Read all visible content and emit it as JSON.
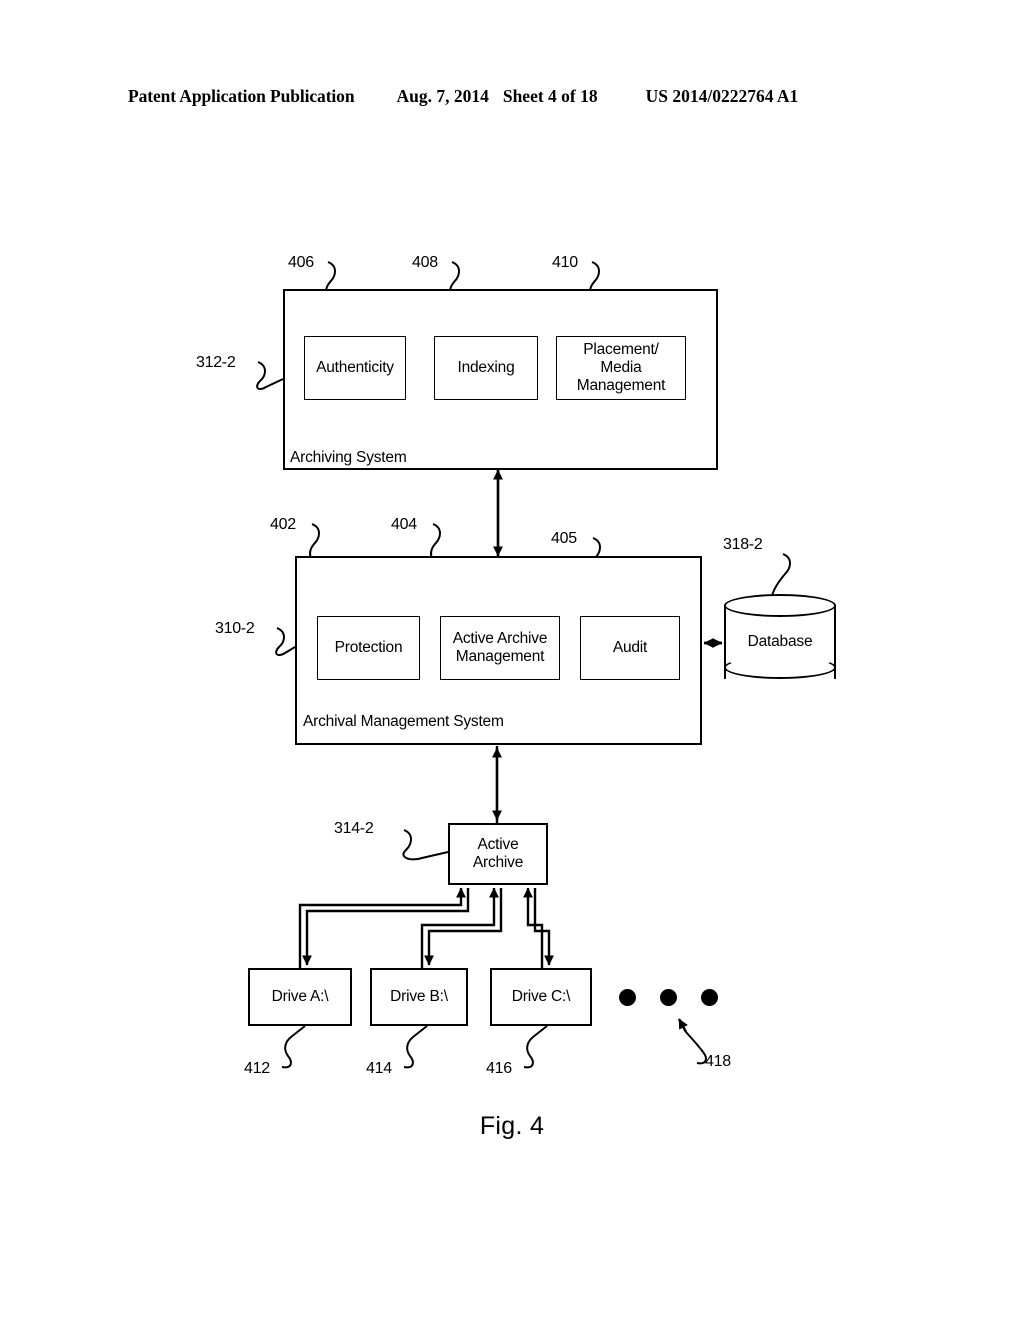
{
  "header": {
    "publication": "Patent Application Publication",
    "date": "Aug. 7, 2014",
    "sheet": "Sheet 4 of 18",
    "patent_number": "US 2014/0222764 A1"
  },
  "figure": {
    "caption": "Fig. 4"
  },
  "archiving_system": {
    "title": "Archiving System",
    "ref": "312-2",
    "components": [
      {
        "label": "Authenticity",
        "ref": "406"
      },
      {
        "label": "Indexing",
        "ref": "408"
      },
      {
        "label": "Placement/\nMedia\nManagement",
        "ref": "410"
      }
    ]
  },
  "archival_management_system": {
    "title": "Archival Management System",
    "ref": "310-2",
    "components": [
      {
        "label": "Protection",
        "ref": "402"
      },
      {
        "label": "Active Archive\nManagement",
        "ref": "404"
      },
      {
        "label": "Audit",
        "ref": "405"
      }
    ]
  },
  "database": {
    "label": "Database",
    "ref": "318-2"
  },
  "active_archive": {
    "label": "Active\nArchive",
    "ref": "314-2"
  },
  "drives": [
    {
      "label": "Drive A:\\",
      "ref": "412"
    },
    {
      "label": "Drive B:\\",
      "ref": "414"
    },
    {
      "label": "Drive C:\\",
      "ref": "416"
    }
  ],
  "more_drives": {
    "ref": "418",
    "indicator": "ellipsis-dots"
  },
  "colors": {
    "ink": "#000000",
    "paper": "#ffffff"
  }
}
